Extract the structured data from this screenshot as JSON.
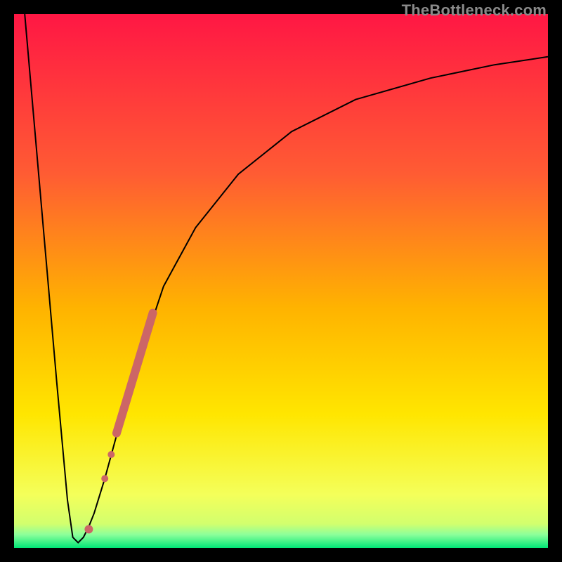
{
  "watermark": "TheBottleneck.com",
  "chart_data": {
    "type": "line",
    "title": "",
    "xlabel": "",
    "ylabel": "",
    "xlim": [
      0,
      100
    ],
    "ylim": [
      0,
      100
    ],
    "grid": false,
    "legend": false,
    "background_gradient": {
      "stops": [
        {
          "pos": 0.0,
          "color": "#ff1744"
        },
        {
          "pos": 0.3,
          "color": "#ff5c33"
        },
        {
          "pos": 0.55,
          "color": "#ffb300"
        },
        {
          "pos": 0.75,
          "color": "#ffe600"
        },
        {
          "pos": 0.9,
          "color": "#f4ff5a"
        },
        {
          "pos": 0.955,
          "color": "#d2ff6e"
        },
        {
          "pos": 0.975,
          "color": "#8cff9b"
        },
        {
          "pos": 1.0,
          "color": "#00e676"
        }
      ]
    },
    "series": [
      {
        "name": "bottleneck-curve",
        "x": [
          2,
          4,
          6,
          8,
          10,
          11,
          12,
          13,
          14,
          15,
          17,
          20,
          24,
          28,
          34,
          42,
          52,
          64,
          78,
          90,
          100
        ],
        "y": [
          100,
          77,
          54,
          31,
          9,
          2,
          1,
          2,
          4,
          6.5,
          13,
          24,
          37,
          49,
          60,
          70,
          78,
          84,
          88,
          90.5,
          92
        ]
      }
    ],
    "markers": [
      {
        "name": "highlight-dot",
        "x": 14.0,
        "y": 3.5,
        "r": 6,
        "color": "#cc6666"
      },
      {
        "name": "highlight-dot",
        "x": 17.0,
        "y": 13.0,
        "r": 5,
        "color": "#cc6666"
      },
      {
        "name": "highlight-dot",
        "x": 18.2,
        "y": 17.5,
        "r": 5,
        "color": "#cc6666"
      }
    ],
    "segments": [
      {
        "name": "highlight-segment",
        "x1": 19.2,
        "y1": 21.5,
        "x2": 26.0,
        "y2": 44.0,
        "width": 12,
        "color": "#cc6666"
      }
    ]
  }
}
